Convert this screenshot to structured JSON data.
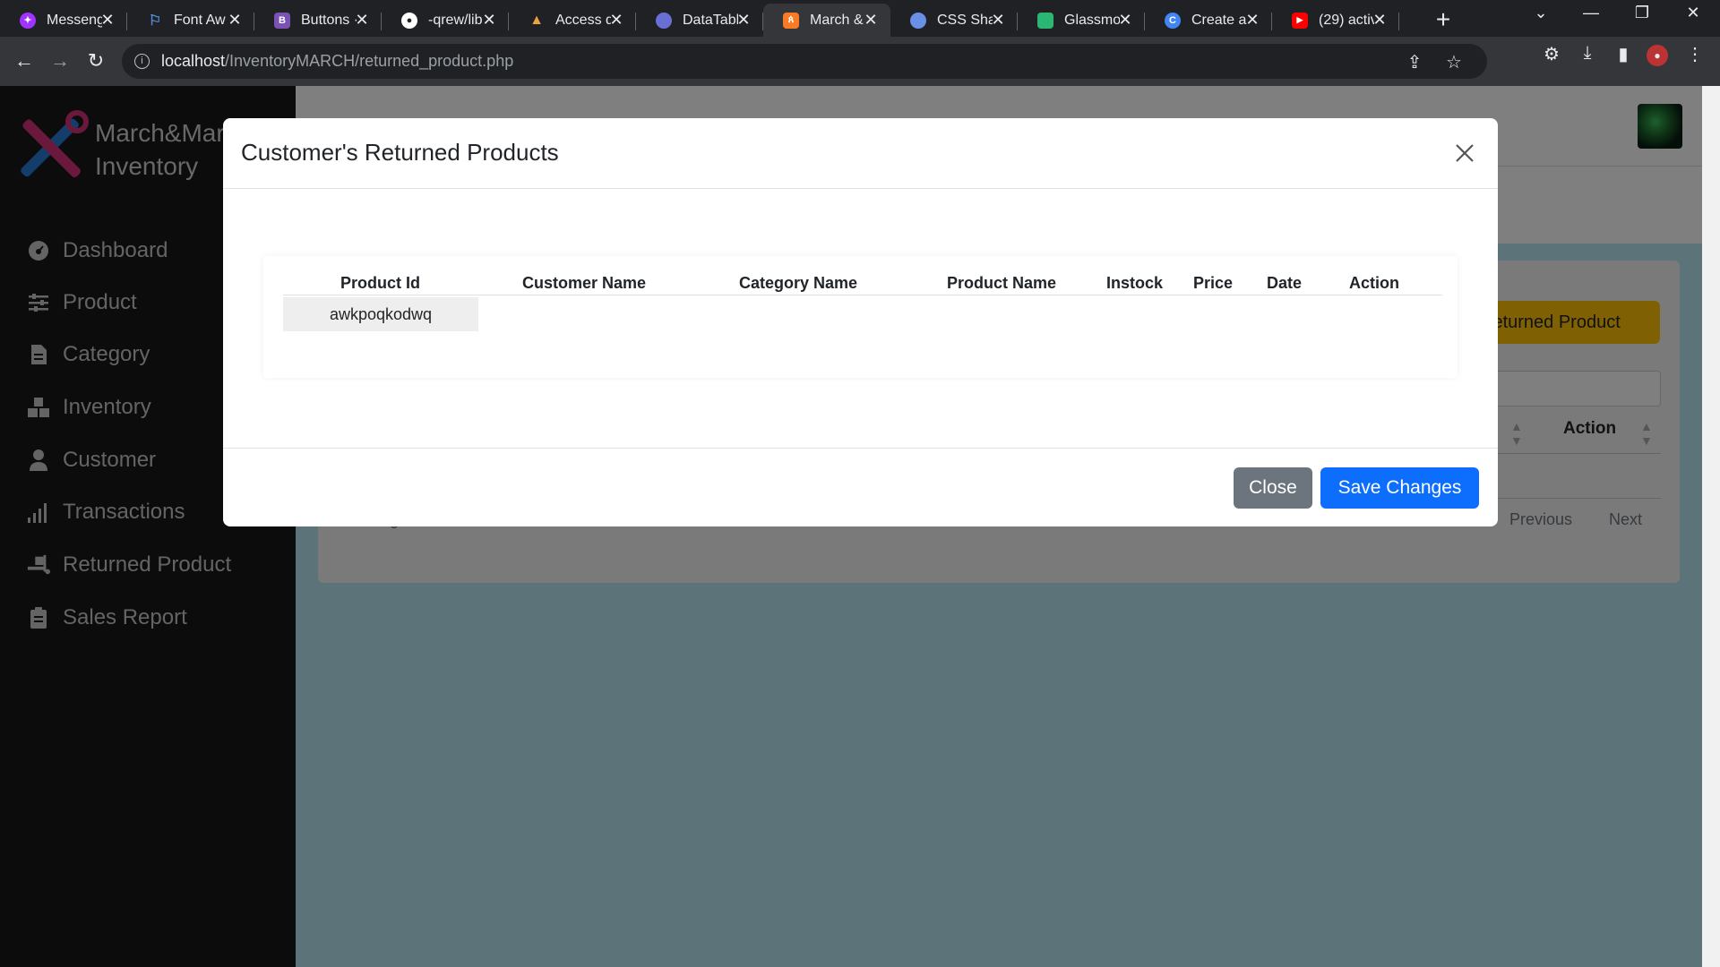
{
  "browser": {
    "tabs": [
      {
        "label": "Messeng",
        "icon": "messenger-icon",
        "color": "#a033ff"
      },
      {
        "label": "Font Aw",
        "icon": "flag-icon",
        "color": "#538dd7"
      },
      {
        "label": "Buttons ·",
        "icon": "bootstrap-icon",
        "color": "#7952b3"
      },
      {
        "label": "-qrew/lib",
        "icon": "github-icon",
        "color": "#ffffff"
      },
      {
        "label": "Access d",
        "icon": "mountain-icon",
        "color": "#e8a33d"
      },
      {
        "label": "DataTabl",
        "icon": "datatables-icon",
        "color": "#6a6fd6"
      },
      {
        "label": "March &",
        "icon": "xampp-icon",
        "color": "#fb7a24"
      },
      {
        "label": "CSS Sha",
        "icon": "globe-icon",
        "color": "#6a8fe6"
      },
      {
        "label": "Glassmo",
        "icon": "glass-icon",
        "color": "#2bb673"
      },
      {
        "label": "Create a",
        "icon": "google-icon",
        "color": "#4285f4"
      },
      {
        "label": "(29) activ",
        "icon": "youtube-icon",
        "color": "#ff0000"
      }
    ],
    "url_host": "localhost",
    "url_path": "/InventoryMARCH/returned_product.php"
  },
  "sidebar": {
    "brand_line1": "March&Mar",
    "brand_line2": "Inventory",
    "items": [
      {
        "label": "Dashboard",
        "icon": "dashboard-icon"
      },
      {
        "label": "Product",
        "icon": "sliders-icon"
      },
      {
        "label": "Category",
        "icon": "file-icon"
      },
      {
        "label": "Inventory",
        "icon": "boxes-icon"
      },
      {
        "label": "Customer",
        "icon": "user-icon"
      },
      {
        "label": "Transactions",
        "icon": "signal-icon"
      },
      {
        "label": "Returned Product",
        "icon": "truck-loading-icon"
      },
      {
        "label": "Sales Report",
        "icon": "clipboard-icon"
      }
    ]
  },
  "background": {
    "returned_product_button": "Returned Product",
    "action_header": "Action",
    "previous": "Previous",
    "next": "Next",
    "showing": "g"
  },
  "modal": {
    "title": "Customer's Returned Products",
    "columns": [
      "Product Id",
      "Customer Name",
      "Category Name",
      "Product Name",
      "Instock",
      "Price",
      "Date",
      "Action"
    ],
    "rows": [
      [
        "awkpoqkodwq"
      ]
    ],
    "close_label": "Close",
    "save_label": "Save Changes"
  },
  "colors": {
    "save_button": "#0d6efd",
    "close_button": "#6c757d",
    "returned_button": "#ffc107",
    "sidebar_bg": "#19191b",
    "content_bg": "#b6e6f3"
  }
}
